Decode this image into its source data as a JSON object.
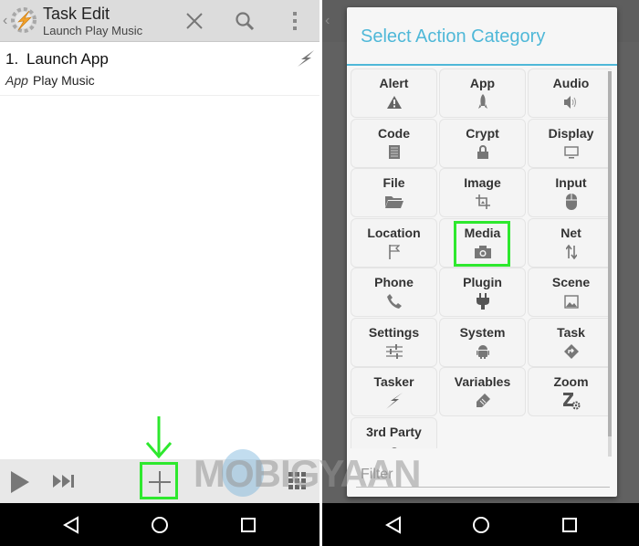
{
  "left_screen": {
    "actionbar": {
      "title": "Task Edit",
      "subtitle": "Launch Play Music",
      "back_icon": "chevron-left-icon",
      "logo_icon": "tasker-gear-bolt-icon",
      "actions": [
        {
          "name": "close",
          "icon": "close-icon",
          "glyph": "✕"
        },
        {
          "name": "search",
          "icon": "search-icon"
        },
        {
          "name": "overflow",
          "icon": "more-vert-icon",
          "glyph": "⋮"
        }
      ]
    },
    "task_actions": [
      {
        "number": "1.",
        "name": "Launch App",
        "category": "App",
        "argument": "Play Music",
        "icon": "tasker-bolt-icon"
      }
    ],
    "bottombar": {
      "buttons": [
        {
          "name": "play",
          "icon": "play-icon"
        },
        {
          "name": "step",
          "icon": "skip-next-icon"
        },
        {
          "name": "add",
          "icon": "plus-icon",
          "highlighted": true
        },
        {
          "name": "grid",
          "icon": "grid-icon"
        }
      ]
    },
    "annotation": {
      "arrow_color": "#2ee82e",
      "highlight_color": "#2ee82e"
    }
  },
  "right_screen": {
    "dialog": {
      "title": "Select Action Category",
      "title_color": "#4fb8d8",
      "categories": [
        {
          "label": "Alert",
          "icon": "warning-icon"
        },
        {
          "label": "App",
          "icon": "rocket-icon"
        },
        {
          "label": "Audio",
          "icon": "speaker-icon"
        },
        {
          "label": "Code",
          "icon": "document-icon"
        },
        {
          "label": "Crypt",
          "icon": "lock-icon"
        },
        {
          "label": "Display",
          "icon": "monitor-icon"
        },
        {
          "label": "File",
          "icon": "folder-icon"
        },
        {
          "label": "Image",
          "icon": "crop-icon"
        },
        {
          "label": "Input",
          "icon": "mouse-icon"
        },
        {
          "label": "Location",
          "icon": "flag-icon"
        },
        {
          "label": "Media",
          "icon": "camera-icon",
          "highlighted": true
        },
        {
          "label": "Net",
          "icon": "up-down-arrows-icon"
        },
        {
          "label": "Phone",
          "icon": "phone-icon"
        },
        {
          "label": "Plugin",
          "icon": "plug-icon"
        },
        {
          "label": "Scene",
          "icon": "picture-icon"
        },
        {
          "label": "Settings",
          "icon": "sliders-icon"
        },
        {
          "label": "System",
          "icon": "android-icon"
        },
        {
          "label": "Task",
          "icon": "diamond-arrow-icon"
        },
        {
          "label": "Tasker",
          "icon": "tasker-bolt-icon"
        },
        {
          "label": "Variables",
          "icon": "tag-icon"
        },
        {
          "label": "Zoom",
          "icon": "zoom-gear-icon"
        },
        {
          "label": "3rd Party",
          "icon": "third-party-icon"
        }
      ],
      "filter": {
        "placeholder": "Filter",
        "value": ""
      }
    }
  },
  "navbar": {
    "buttons": [
      {
        "name": "back",
        "icon": "back-triangle-icon"
      },
      {
        "name": "home",
        "icon": "home-circle-icon"
      },
      {
        "name": "recents",
        "icon": "recents-square-icon"
      }
    ]
  },
  "watermark": {
    "text": "MOBIGYAAN"
  }
}
